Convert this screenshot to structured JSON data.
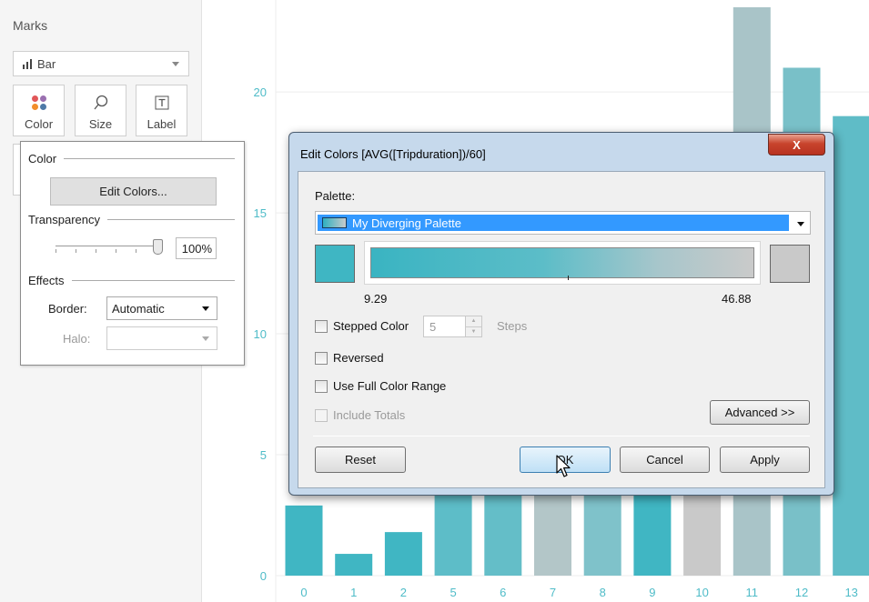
{
  "marks": {
    "title": "Marks",
    "mark_type": "Bar",
    "cards": {
      "color": "Color",
      "size": "Size",
      "label": "Label"
    },
    "color_popup": {
      "color_section": "Color",
      "edit_colors_button": "Edit Colors...",
      "transparency_section": "Transparency",
      "transparency_value": "100%",
      "transparency_level": 1.0,
      "effects_section": "Effects",
      "border_label": "Border:",
      "border_value": "Automatic",
      "halo_label": "Halo:",
      "halo_value": ""
    }
  },
  "chart_data": {
    "type": "bar",
    "categories": [
      "0",
      "1",
      "2",
      "5",
      "6",
      "7",
      "8",
      "9",
      "10",
      "11",
      "12",
      "13"
    ],
    "values": [
      2.9,
      0.9,
      1.8,
      4.0,
      4.0,
      4.0,
      4.0,
      4.0,
      4.0,
      23.5,
      21.0,
      19.0
    ],
    "bar_colors": [
      "#40b6c3",
      "#40b6c3",
      "#40b6c3",
      "#5dbdc8",
      "#64bec8",
      "#b3c6c8",
      "#7fc2ca",
      "#40b6c3",
      "#c9c9c9",
      "#a9c4c8",
      "#79c0c8",
      "#5fbcc7"
    ],
    "ylim": [
      0,
      23.5
    ],
    "yticks": [
      "0",
      "5",
      "10",
      "15",
      "20"
    ],
    "title": "",
    "xlabel": "",
    "ylabel": "",
    "grid": true,
    "axis_label_color": "#4fbcc8"
  },
  "dialog": {
    "title": "Edit Colors [AVG([Tripduration])/60]",
    "close_label": "X",
    "palette_label": "Palette:",
    "palette_value": "My Diverging Palette",
    "start_color": "#3fb6c3",
    "end_color": "#c9c9c9",
    "range_min": "9.29",
    "range_max": "46.88",
    "stepped_color_label": "Stepped Color",
    "steps_value": "5",
    "steps_label": "Steps",
    "reversed_label": "Reversed",
    "full_range_label": "Use Full Color Range",
    "include_totals_label": "Include Totals",
    "advanced_label": "Advanced >>",
    "reset_label": "Reset",
    "ok_label": "OK",
    "cancel_label": "Cancel",
    "apply_label": "Apply"
  },
  "icons": {
    "color": "color-dots-icon",
    "size": "size-lasso-icon",
    "label": "text-label-icon",
    "mark_type": "bar-chart-icon",
    "cursor": "mouse-pointer-icon"
  }
}
